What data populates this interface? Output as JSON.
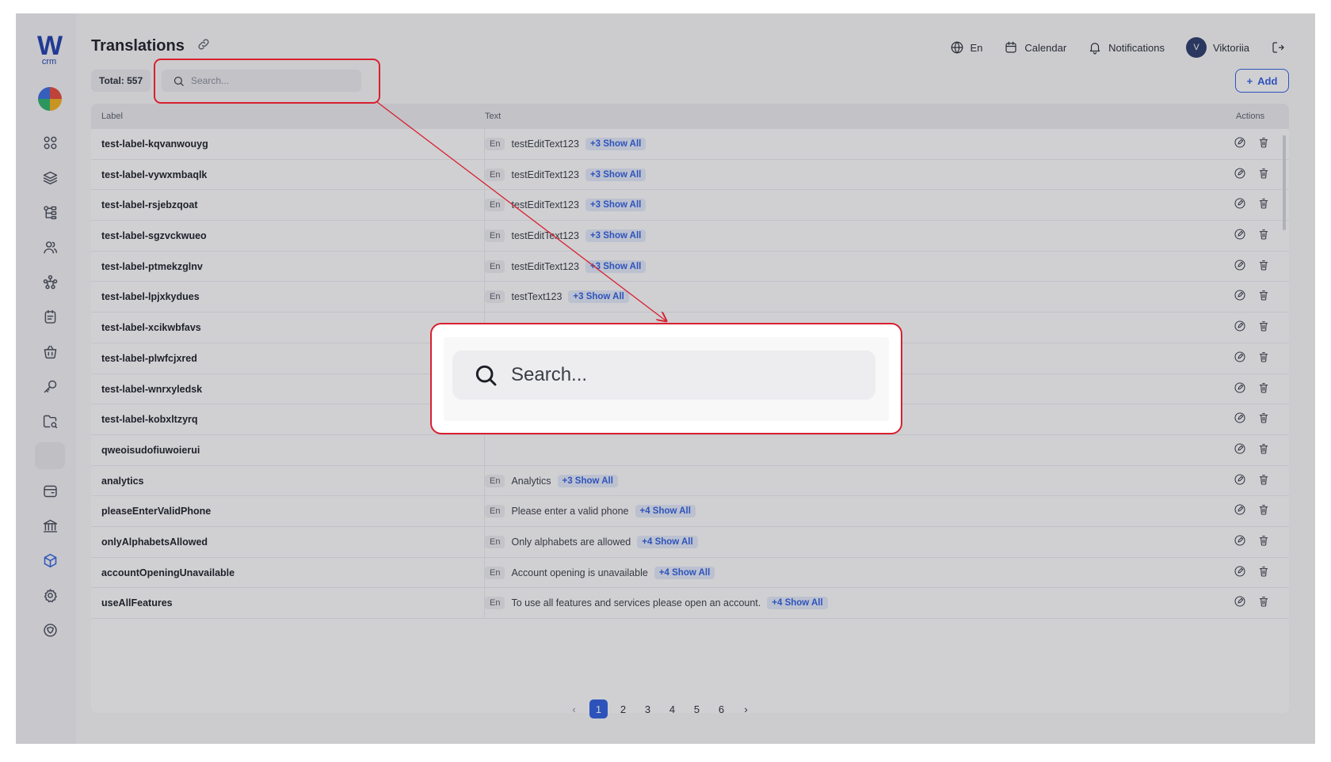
{
  "app": {
    "logo_text": "W",
    "logo_sub": "crm"
  },
  "page": {
    "title": "Translations"
  },
  "topbar": {
    "language": "En",
    "calendar": "Calendar",
    "notifications": "Notifications",
    "user_initial": "V",
    "user_name": "Viktoriia"
  },
  "toolbar": {
    "total": "Total: 557",
    "search_placeholder": "Search...",
    "add_label": "Add"
  },
  "table": {
    "columns": [
      "Label",
      "Text",
      "Actions"
    ],
    "rows": [
      {
        "label": "test-label-kqvanwouyg",
        "lang": "En",
        "text": "testEditText123",
        "more": "+3 Show All"
      },
      {
        "label": "test-label-vywxmbaqlk",
        "lang": "En",
        "text": "testEditText123",
        "more": "+3 Show All"
      },
      {
        "label": "test-label-rsjebzqoat",
        "lang": "En",
        "text": "testEditText123",
        "more": "+3 Show All"
      },
      {
        "label": "test-label-sgzvckwueo",
        "lang": "En",
        "text": "testEditText123",
        "more": "+3 Show All"
      },
      {
        "label": "test-label-ptmekzglnv",
        "lang": "En",
        "text": "testEditText123",
        "more": "+3 Show All"
      },
      {
        "label": "test-label-lpjxkydues",
        "lang": "En",
        "text": "testText123",
        "more": "+3 Show All"
      },
      {
        "label": "test-label-xcikwbfavs",
        "lang": "",
        "text": "",
        "more": ""
      },
      {
        "label": "test-label-plwfcjxred",
        "lang": "",
        "text": "",
        "more": ""
      },
      {
        "label": "test-label-wnrxyledsk",
        "lang": "",
        "text": "",
        "more": ""
      },
      {
        "label": "test-label-kobxltzyrq",
        "lang": "",
        "text": "",
        "more": ""
      },
      {
        "label": "qweoisudofiuwoierui",
        "lang": "",
        "text": "",
        "more": ""
      },
      {
        "label": "analytics",
        "lang": "En",
        "text": "Analytics",
        "more": "+3 Show All"
      },
      {
        "label": "pleaseEnterValidPhone",
        "lang": "En",
        "text": "Please enter a valid phone",
        "more": "+4 Show All"
      },
      {
        "label": "onlyAlphabetsAllowed",
        "lang": "En",
        "text": "Only alphabets are allowed",
        "more": "+4 Show All"
      },
      {
        "label": "accountOpeningUnavailable",
        "lang": "En",
        "text": "Account opening is unavailable",
        "more": "+4 Show All"
      },
      {
        "label": "useAllFeatures",
        "lang": "En",
        "text": "To use all features and services please open an account.",
        "more": "+4 Show All"
      }
    ]
  },
  "pagination": {
    "pages": [
      "1",
      "2",
      "3",
      "4",
      "5",
      "6"
    ],
    "current": "1"
  },
  "callout": {
    "search_placeholder": "Search..."
  },
  "colors": {
    "accent": "#2f5fe0",
    "callout_red": "#d8202f"
  }
}
